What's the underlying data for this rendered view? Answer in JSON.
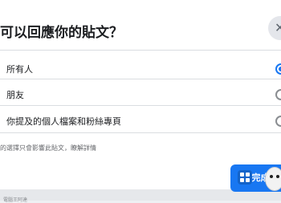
{
  "dialog": {
    "title": "可以回應你的貼文？",
    "close_icon": "✕"
  },
  "options": [
    {
      "label": "所有人",
      "selected": true
    },
    {
      "label": "朋友",
      "selected": false
    },
    {
      "label": "你提及的個人檔案和粉絲專頁",
      "selected": false
    }
  ],
  "note": "的選擇只會影響此貼文，瞭解詳情",
  "footer": {
    "done_label": "完成",
    "bottom_text": "電腦王阿達"
  },
  "colors": {
    "accent": "#1877f2",
    "divider": "#dadde1"
  },
  "icons": [
    "close-icon",
    "radio-selected-icon",
    "radio-unselected-icon",
    "app-badge-icon",
    "mascot-icon"
  ]
}
